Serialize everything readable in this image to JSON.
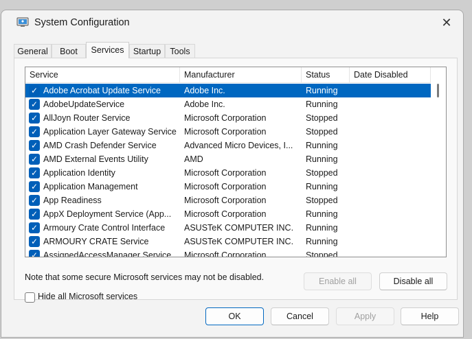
{
  "window": {
    "title": "System Configuration",
    "close_glyph": "✕"
  },
  "tabs": [
    "General",
    "Boot",
    "Services",
    "Startup",
    "Tools"
  ],
  "active_tab": "Services",
  "columns": [
    "Service",
    "Manufacturer",
    "Status",
    "Date Disabled"
  ],
  "services": [
    {
      "name": "Adobe Acrobat Update Service",
      "manufacturer": "Adobe Inc.",
      "status": "Running",
      "date_disabled": "",
      "checked": true,
      "selected": true
    },
    {
      "name": "AdobeUpdateService",
      "manufacturer": "Adobe Inc.",
      "status": "Running",
      "date_disabled": "",
      "checked": true
    },
    {
      "name": "AllJoyn Router Service",
      "manufacturer": "Microsoft Corporation",
      "status": "Stopped",
      "date_disabled": "",
      "checked": true
    },
    {
      "name": "Application Layer Gateway Service",
      "manufacturer": "Microsoft Corporation",
      "status": "Stopped",
      "date_disabled": "",
      "checked": true
    },
    {
      "name": "AMD Crash Defender Service",
      "manufacturer": "Advanced Micro Devices, I...",
      "status": "Running",
      "date_disabled": "",
      "checked": true
    },
    {
      "name": "AMD External Events Utility",
      "manufacturer": "AMD",
      "status": "Running",
      "date_disabled": "",
      "checked": true
    },
    {
      "name": "Application Identity",
      "manufacturer": "Microsoft Corporation",
      "status": "Stopped",
      "date_disabled": "",
      "checked": true
    },
    {
      "name": "Application Management",
      "manufacturer": "Microsoft Corporation",
      "status": "Running",
      "date_disabled": "",
      "checked": true
    },
    {
      "name": "App Readiness",
      "manufacturer": "Microsoft Corporation",
      "status": "Stopped",
      "date_disabled": "",
      "checked": true
    },
    {
      "name": "AppX Deployment Service (App...",
      "manufacturer": "Microsoft Corporation",
      "status": "Running",
      "date_disabled": "",
      "checked": true
    },
    {
      "name": "Armoury Crate Control Interface",
      "manufacturer": "ASUSTeK COMPUTER INC.",
      "status": "Running",
      "date_disabled": "",
      "checked": true
    },
    {
      "name": "ARMOURY CRATE Service",
      "manufacturer": "ASUSTeK COMPUTER INC.",
      "status": "Running",
      "date_disabled": "",
      "checked": true
    },
    {
      "name": "AssignedAccessManager Service",
      "manufacturer": "Microsoft Corporation",
      "status": "Stopped",
      "date_disabled": "",
      "checked": true
    }
  ],
  "note": "Note that some secure Microsoft services may not be disabled.",
  "enable_all": "Enable all",
  "disable_all": "Disable all",
  "hide_ms_label": "Hide all Microsoft services",
  "buttons": {
    "ok": "OK",
    "cancel": "Cancel",
    "apply": "Apply",
    "help": "Help"
  },
  "icons": {
    "app": "system-config-icon",
    "close": "close-icon",
    "check": "checkmark-icon"
  },
  "colors": {
    "selection": "#0067c0",
    "checkbox": "#005fb8"
  }
}
